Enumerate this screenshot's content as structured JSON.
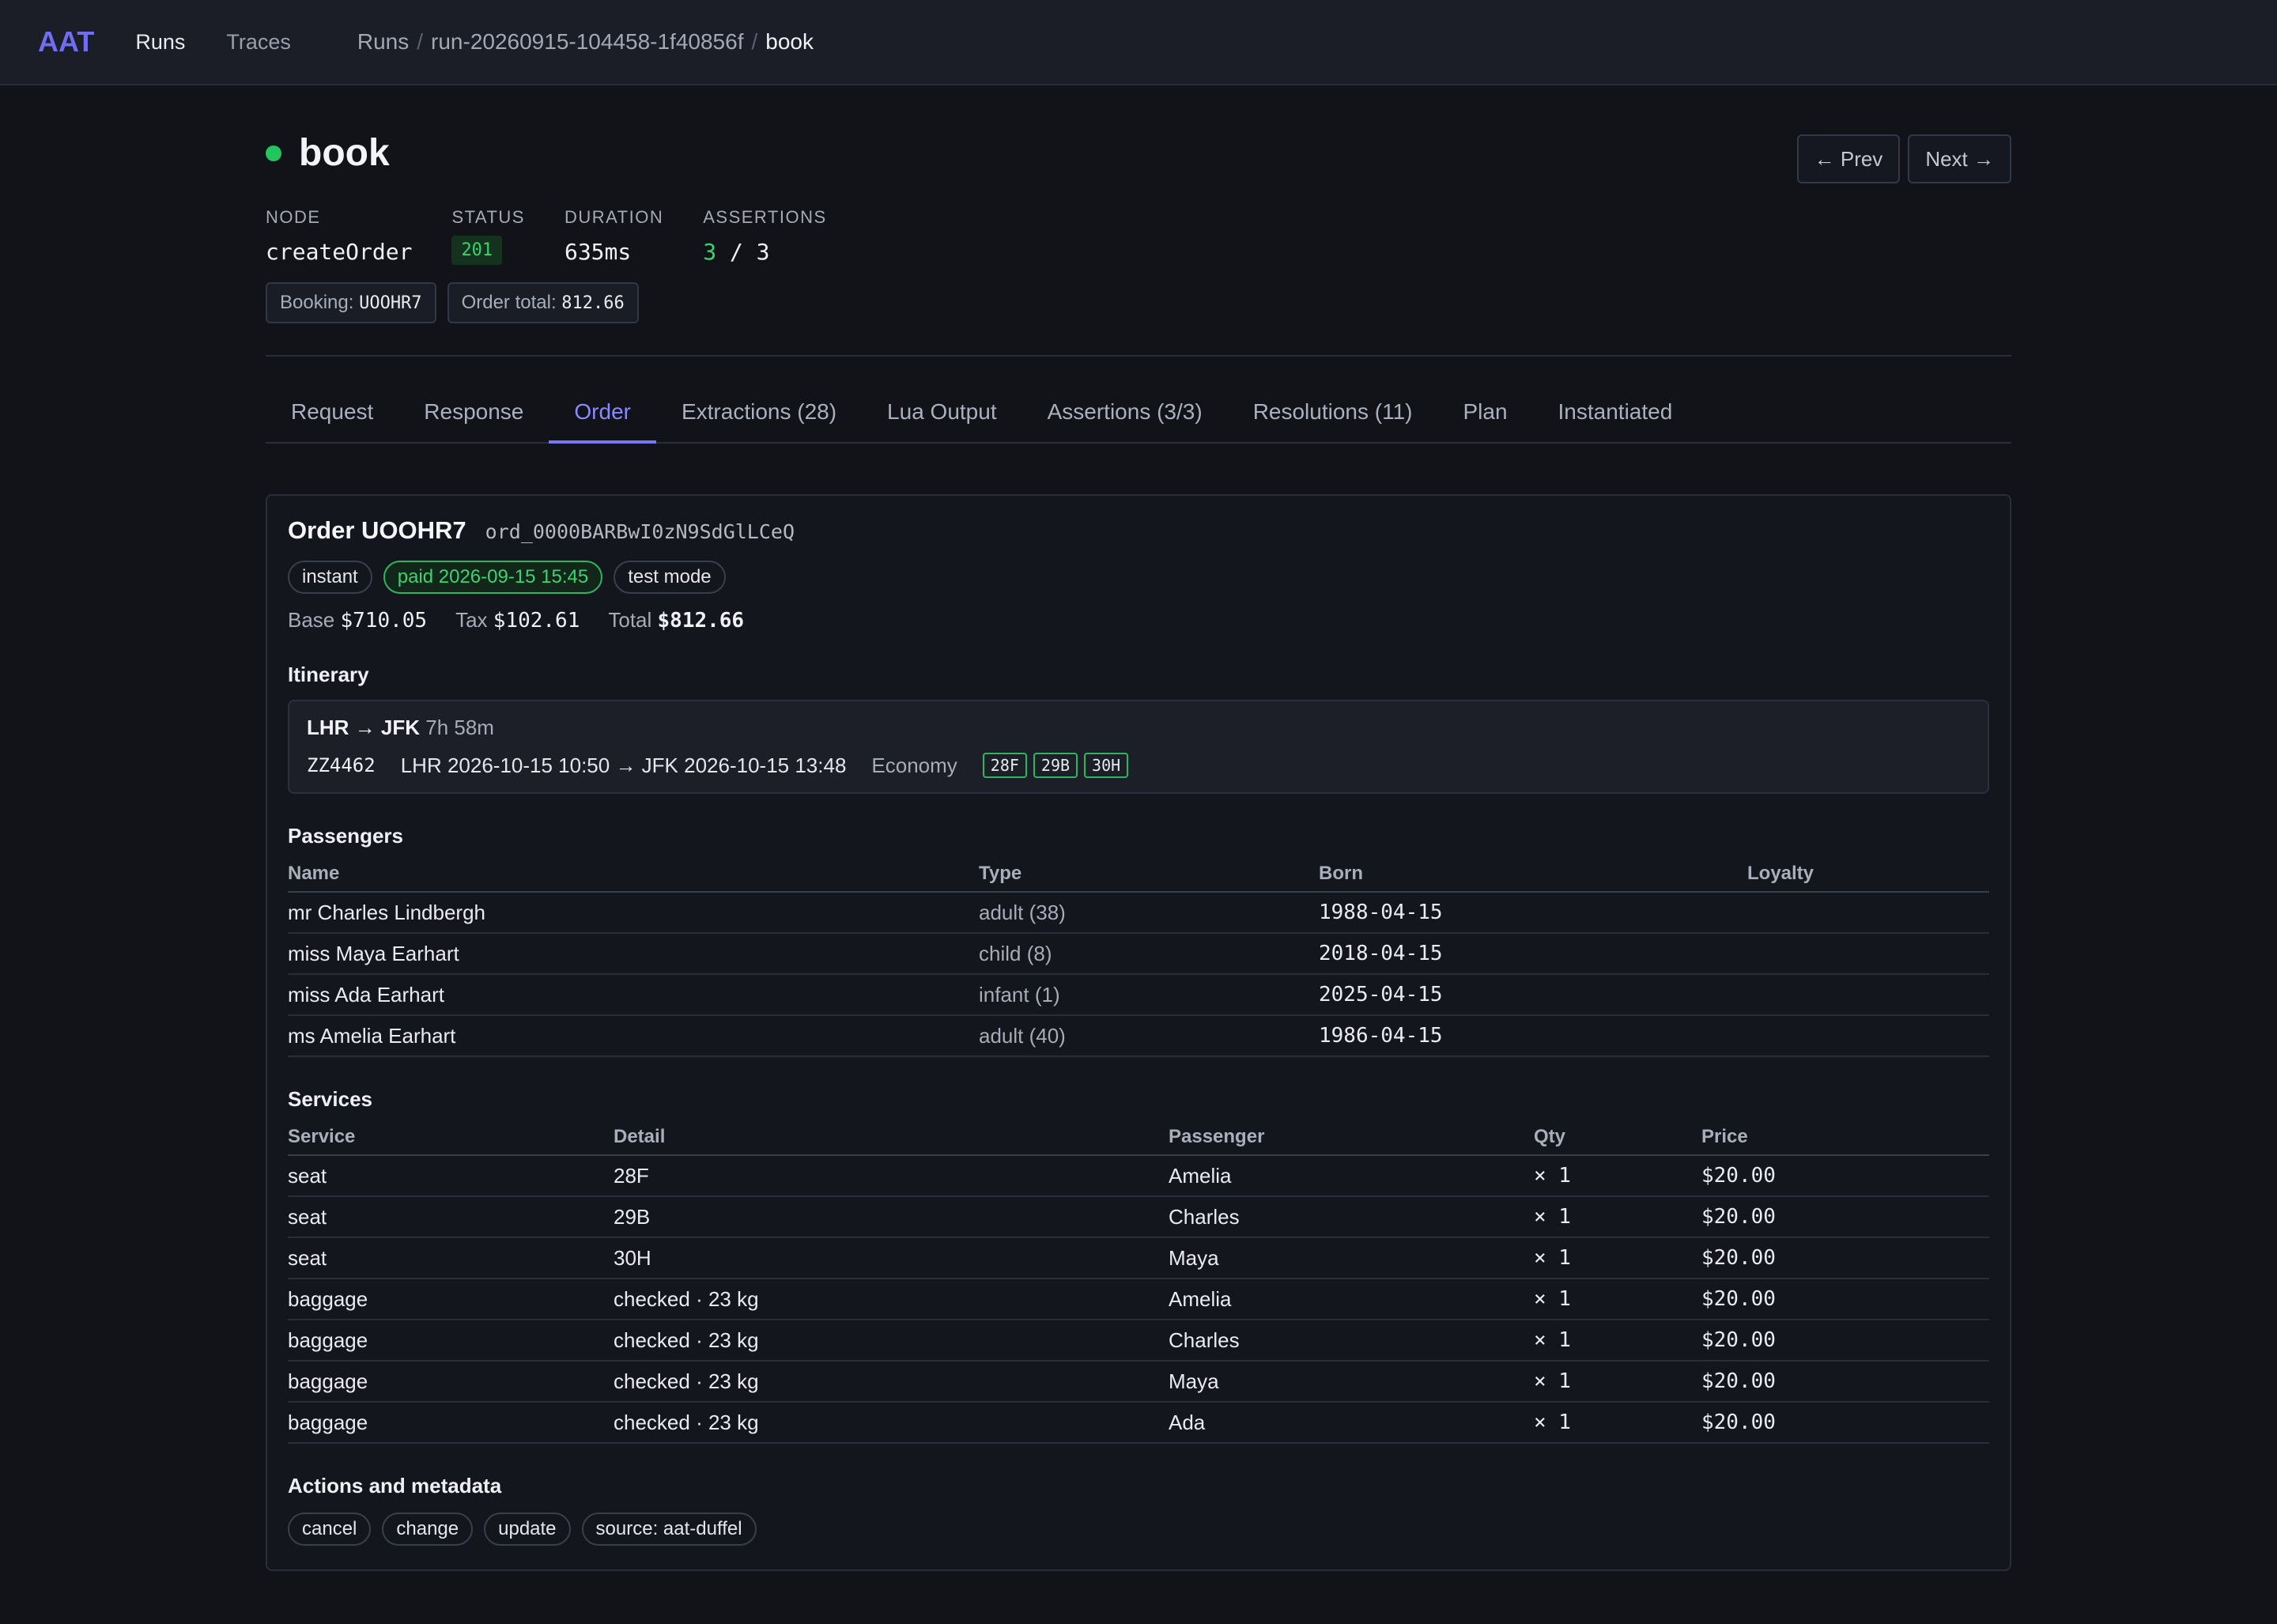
{
  "nav": {
    "brand": "AAT",
    "links": [
      "Runs",
      "Traces"
    ],
    "breadcrumb": [
      "Runs",
      "run-20260915-104458-1f40856f",
      "book"
    ]
  },
  "header": {
    "title": "book",
    "prev_label": "← Prev",
    "next_label": "Next →",
    "meta": {
      "node_label": "NODE",
      "node_value": "createOrder",
      "status_label": "STATUS",
      "status_value": "201",
      "duration_label": "DURATION",
      "duration_value": "635ms",
      "assertions_label": "ASSERTIONS",
      "assertions_passed": "3",
      "assertions_sep": "/",
      "assertions_total": "3"
    },
    "chips": {
      "booking_label": "Booking:",
      "booking_value": "UOOHR7",
      "total_label": "Order total:",
      "total_value": "812.66"
    }
  },
  "tabs": [
    "Request",
    "Response",
    "Order",
    "Extractions (28)",
    "Lua Output",
    "Assertions (3/3)",
    "Resolutions (11)",
    "Plan",
    "Instantiated"
  ],
  "active_tab": "Order",
  "order": {
    "title": "Order UOOHR7",
    "id": "ord_0000BARBwI0zN9SdGlLCeQ",
    "pills": [
      "instant",
      "paid 2026-09-15 15:45",
      "test mode"
    ],
    "base_label": "Base",
    "base_value": "$710.05",
    "tax_label": "Tax",
    "tax_value": "$102.61",
    "total_label": "Total",
    "total_value": "$812.66"
  },
  "itinerary": {
    "title": "Itinerary",
    "route": "LHR → JFK",
    "duration": "7h 58m",
    "flight": "ZZ4462",
    "times": "LHR 2026-10-15 10:50 → JFK 2026-10-15 13:48",
    "cabin": "Economy",
    "seats": [
      "28F",
      "29B",
      "30H"
    ]
  },
  "passengers": {
    "title": "Passengers",
    "columns": [
      "Name",
      "Type",
      "Born",
      "Loyalty"
    ],
    "rows": [
      {
        "name": "mr Charles Lindbergh",
        "type": "adult (38)",
        "born": "1988-04-15",
        "loyalty": ""
      },
      {
        "name": "miss Maya Earhart",
        "type": "child (8)",
        "born": "2018-04-15",
        "loyalty": ""
      },
      {
        "name": "miss Ada Earhart",
        "type": "infant (1)",
        "born": "2025-04-15",
        "loyalty": ""
      },
      {
        "name": "ms Amelia Earhart",
        "type": "adult (40)",
        "born": "1986-04-15",
        "loyalty": ""
      }
    ]
  },
  "services": {
    "title": "Services",
    "columns": [
      "Service",
      "Detail",
      "Passenger",
      "Qty",
      "Price"
    ],
    "rows": [
      {
        "service": "seat",
        "detail": "28F",
        "passenger": "Amelia",
        "qty": "× 1",
        "price": "$20.00"
      },
      {
        "service": "seat",
        "detail": "29B",
        "passenger": "Charles",
        "qty": "× 1",
        "price": "$20.00"
      },
      {
        "service": "seat",
        "detail": "30H",
        "passenger": "Maya",
        "qty": "× 1",
        "price": "$20.00"
      },
      {
        "service": "baggage",
        "detail": "checked · 23 kg",
        "passenger": "Amelia",
        "qty": "× 1",
        "price": "$20.00"
      },
      {
        "service": "baggage",
        "detail": "checked · 23 kg",
        "passenger": "Charles",
        "qty": "× 1",
        "price": "$20.00"
      },
      {
        "service": "baggage",
        "detail": "checked · 23 kg",
        "passenger": "Maya",
        "qty": "× 1",
        "price": "$20.00"
      },
      {
        "service": "baggage",
        "detail": "checked · 23 kg",
        "passenger": "Ada",
        "qty": "× 1",
        "price": "$20.00"
      }
    ]
  },
  "actions": {
    "title": "Actions and metadata",
    "items": [
      "cancel",
      "change",
      "update",
      "source: aat-duffel"
    ]
  },
  "colors": {
    "accent": "#7776f5",
    "success": "#22c55e",
    "background": "#111318"
  }
}
